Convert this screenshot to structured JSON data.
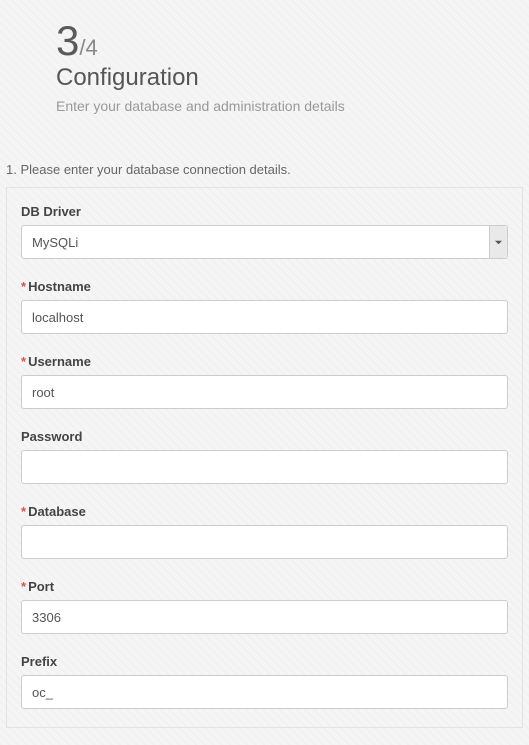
{
  "step": {
    "current": "3",
    "total": "/4"
  },
  "title": "Configuration",
  "subtitle": "Enter your database and administration details",
  "section_heading": "1. Please enter your database connection details.",
  "fields": {
    "db_driver": {
      "label": "DB Driver",
      "value": "MySQLi",
      "required": false,
      "options": [
        "MySQLi"
      ]
    },
    "hostname": {
      "label": "Hostname",
      "value": "localhost",
      "required": true
    },
    "username": {
      "label": "Username",
      "value": "root",
      "required": true
    },
    "password": {
      "label": "Password",
      "value": "",
      "required": false
    },
    "database": {
      "label": "Database",
      "value": "",
      "required": true
    },
    "port": {
      "label": "Port",
      "value": "3306",
      "required": true
    },
    "prefix": {
      "label": "Prefix",
      "value": "oc_",
      "required": false
    }
  },
  "required_marker": "*"
}
